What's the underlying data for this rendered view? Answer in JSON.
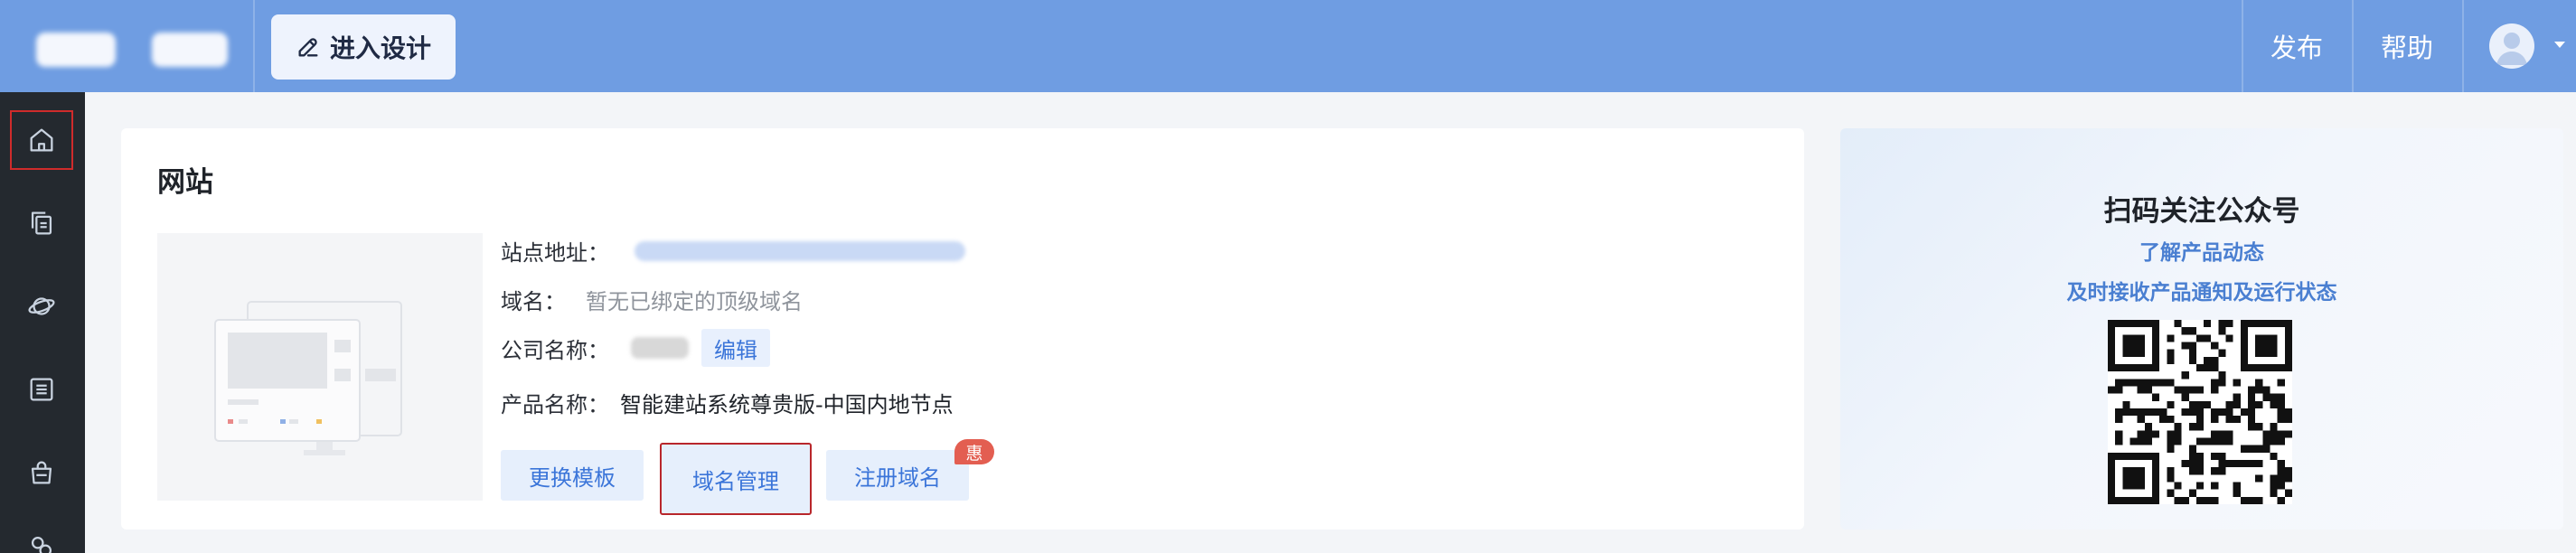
{
  "topbar": {
    "design_button_label": "进入设计",
    "publish_label": "发布",
    "help_label": "帮助"
  },
  "sidebar": {
    "items": [
      {
        "icon": "home-icon",
        "active": true
      },
      {
        "icon": "pages-icon",
        "active": false
      },
      {
        "icon": "planet-icon",
        "active": false
      },
      {
        "icon": "list-icon",
        "active": false
      },
      {
        "icon": "bag-icon",
        "active": false
      },
      {
        "icon": "puzzle-icon",
        "active": false
      }
    ]
  },
  "site_card": {
    "title": "网站",
    "site_address_label": "站点地址：",
    "domain_label": "域名：",
    "domain_value": "暂无已绑定的顶级域名",
    "company_label": "公司名称：",
    "edit_label": "编辑",
    "product_label": "产品名称：",
    "product_value": "智能建站系统尊贵版-中国内地节点",
    "buttons": {
      "change_template": "更换模板",
      "domain_manage": "域名管理",
      "register_domain": "注册域名"
    },
    "promo_badge": "惠"
  },
  "qr_card": {
    "title": "扫码关注公众号",
    "line1": "了解产品动态",
    "line2": "及时接收产品通知及运行状态"
  },
  "colors": {
    "topbar": "#6f9de2",
    "sidebar": "#24292f",
    "accent": "#3b75d9",
    "highlight_border": "#b8262b",
    "badge": "#e35e51"
  }
}
